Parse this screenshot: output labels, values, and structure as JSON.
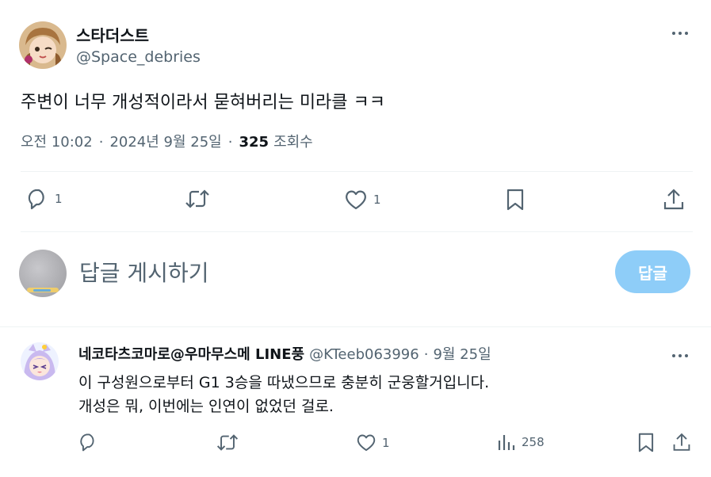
{
  "main_tweet": {
    "display_name": "스타더스트",
    "handle": "@Space_debries",
    "text": "주변이 너무 개성적이라서 묻혀버리는 미라클 ㅋㅋ",
    "time": "오전 10:02",
    "date": "2024년 9월 25일",
    "views": "325",
    "views_label": "조회수",
    "separator": "·",
    "actions": {
      "reply_count": "1",
      "retweet_count": "",
      "like_count": "1"
    }
  },
  "compose": {
    "placeholder": "답글 게시하기",
    "button_label": "답글"
  },
  "reply_tweet": {
    "display_name": "네코타츠코마로@우마무스메 LINE풍",
    "handle": "@KTeeb063996",
    "separator": "·",
    "date": "9월 25일",
    "text_line1": "이 구성원으로부터 G1 3승을 따냈으므로 충분히 군웅할거입니다.",
    "text_line2": "개성은 뭐, 이번에는 인연이 없었던 걸로.",
    "actions": {
      "reply_count": "",
      "retweet_count": "",
      "like_count": "1",
      "views_count": "258"
    }
  },
  "colors": {
    "text_primary": "#0f1419",
    "text_secondary": "#536471",
    "reply_button_bg": "#8ecdf8",
    "divider": "#eff3f4"
  },
  "icons": [
    "more-icon",
    "reply-icon",
    "retweet-icon",
    "like-icon",
    "bookmark-icon",
    "share-icon",
    "views-icon"
  ]
}
